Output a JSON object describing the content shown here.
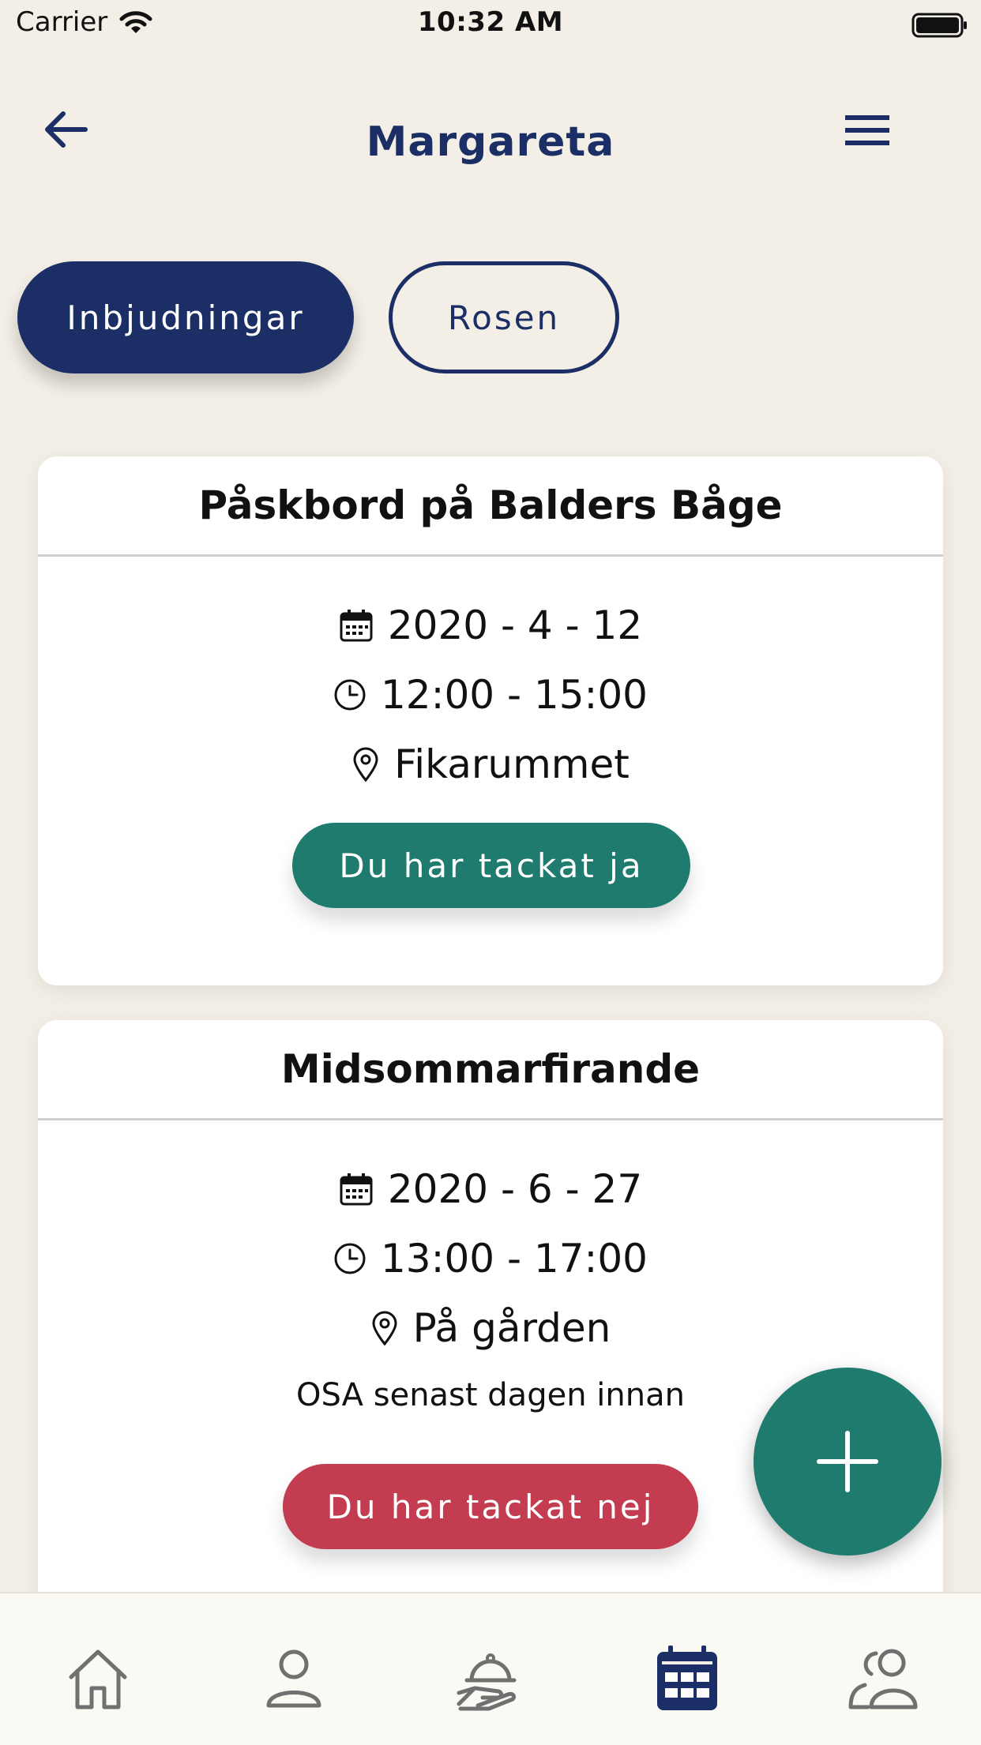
{
  "status_bar": {
    "carrier": "Carrier",
    "time": "10:32 AM"
  },
  "header": {
    "title": "Margareta"
  },
  "tabs": [
    {
      "label": "Inbjudningar",
      "active": true
    },
    {
      "label": "Rosen",
      "active": false
    }
  ],
  "events": [
    {
      "title": "Påskbord på Balders Båge",
      "date": "2020 - 4 - 12",
      "time": "12:00 - 15:00",
      "location": "Fikarummet",
      "note": "",
      "rsvp_label": "Du har tackat ja",
      "rsvp_color": "#1f7b6e"
    },
    {
      "title": "Midsommarfirande",
      "date": "2020 - 6 - 27",
      "time": "13:00 - 17:00",
      "location": "På gården",
      "note": "OSA senast dagen innan",
      "rsvp_label": "Du har tackat nej",
      "rsvp_color": "#c33c4f"
    }
  ],
  "bottom_nav": [
    {
      "icon": "home-icon",
      "active": false
    },
    {
      "icon": "profile-icon",
      "active": false
    },
    {
      "icon": "food-service-icon",
      "active": false
    },
    {
      "icon": "calendar-icon",
      "active": true
    },
    {
      "icon": "group-icon",
      "active": false
    }
  ],
  "colors": {
    "primary": "#1b2f66",
    "accept": "#1f7b6e",
    "decline": "#c33c4f",
    "background": "#f3efe6"
  }
}
